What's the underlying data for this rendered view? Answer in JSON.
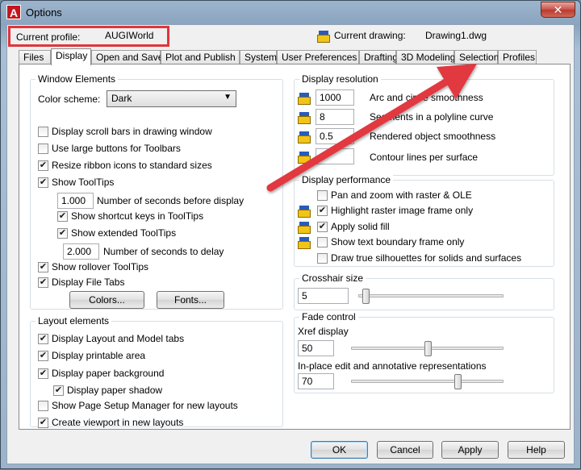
{
  "window": {
    "title": "Options",
    "close_symbol": "✕"
  },
  "header": {
    "current_profile_label": "Current profile:",
    "current_profile_value": "AUGIWorld",
    "current_drawing_label": "Current drawing:",
    "current_drawing_value": "Drawing1.dwg"
  },
  "tabs": [
    {
      "label": "Files"
    },
    {
      "label": "Display",
      "active": true
    },
    {
      "label": "Open and Save"
    },
    {
      "label": "Plot and Publish"
    },
    {
      "label": "System"
    },
    {
      "label": "User Preferences"
    },
    {
      "label": "Drafting"
    },
    {
      "label": "3D Modeling"
    },
    {
      "label": "Selection"
    },
    {
      "label": "Profiles"
    }
  ],
  "window_elements": {
    "title": "Window Elements",
    "color_scheme_label": "Color scheme:",
    "color_scheme_value": "Dark",
    "scroll_bars": {
      "label": "Display scroll bars in drawing window",
      "checked": false
    },
    "large_buttons": {
      "label": "Use large buttons for Toolbars",
      "checked": false
    },
    "resize_ribbon": {
      "label": "Resize ribbon icons to standard sizes",
      "checked": true
    },
    "show_tooltips": {
      "label": "Show ToolTips",
      "checked": true
    },
    "seconds_before_display_value": "1.000",
    "seconds_before_display_label": "Number of seconds before display",
    "shortcut_keys": {
      "label": "Show shortcut keys in ToolTips",
      "checked": true
    },
    "extended_tooltips": {
      "label": "Show extended ToolTips",
      "checked": true
    },
    "seconds_to_delay_value": "2.000",
    "seconds_to_delay_label": "Number of seconds to delay",
    "rollover_tooltips": {
      "label": "Show rollover ToolTips",
      "checked": true
    },
    "file_tabs": {
      "label": "Display File Tabs",
      "checked": true
    },
    "colors_button": "Colors...",
    "fonts_button": "Fonts..."
  },
  "layout_elements": {
    "title": "Layout elements",
    "layout_model_tabs": {
      "label": "Display Layout and Model tabs",
      "checked": true
    },
    "printable_area": {
      "label": "Display printable area",
      "checked": true
    },
    "paper_background": {
      "label": "Display paper background",
      "checked": true
    },
    "paper_shadow": {
      "label": "Display paper shadow",
      "checked": true
    },
    "page_setup_manager": {
      "label": "Show Page Setup Manager for new layouts",
      "checked": false
    },
    "create_viewport": {
      "label": "Create viewport in new layouts",
      "checked": true
    }
  },
  "display_resolution": {
    "title": "Display resolution",
    "rows": [
      {
        "value": "1000",
        "label": "Arc and circle smoothness"
      },
      {
        "value": "8",
        "label": "Segments in a polyline curve"
      },
      {
        "value": "0.5",
        "label": "Rendered object smoothness"
      },
      {
        "value": "",
        "label": "Contour lines per surface"
      }
    ]
  },
  "display_performance": {
    "title": "Display performance",
    "pan_zoom_raster": {
      "label": "Pan and zoom with raster & OLE",
      "checked": false
    },
    "highlight_raster": {
      "label": "Highlight raster image frame only",
      "checked": true
    },
    "apply_solid_fill": {
      "label": "Apply solid fill",
      "checked": true
    },
    "text_boundary": {
      "label": "Show text boundary frame only",
      "checked": false
    },
    "true_silhouettes": {
      "label": "Draw true silhouettes for solids and surfaces",
      "checked": false
    }
  },
  "crosshair": {
    "title": "Crosshair size",
    "value": "5",
    "level": 5
  },
  "fade_control": {
    "title": "Fade control",
    "xref_label": "Xref display",
    "xref_value": "50",
    "xref_level": 50,
    "inplace_label": "In-place edit and annotative representations",
    "inplace_value": "70",
    "inplace_level": 70
  },
  "footer": {
    "ok": "OK",
    "cancel": "Cancel",
    "apply": "Apply",
    "help": "Help"
  },
  "colors": {
    "annotation_red": "#e0353b",
    "dialog_bg": "#f0f0f0",
    "panel_bg": "#ffffff"
  }
}
